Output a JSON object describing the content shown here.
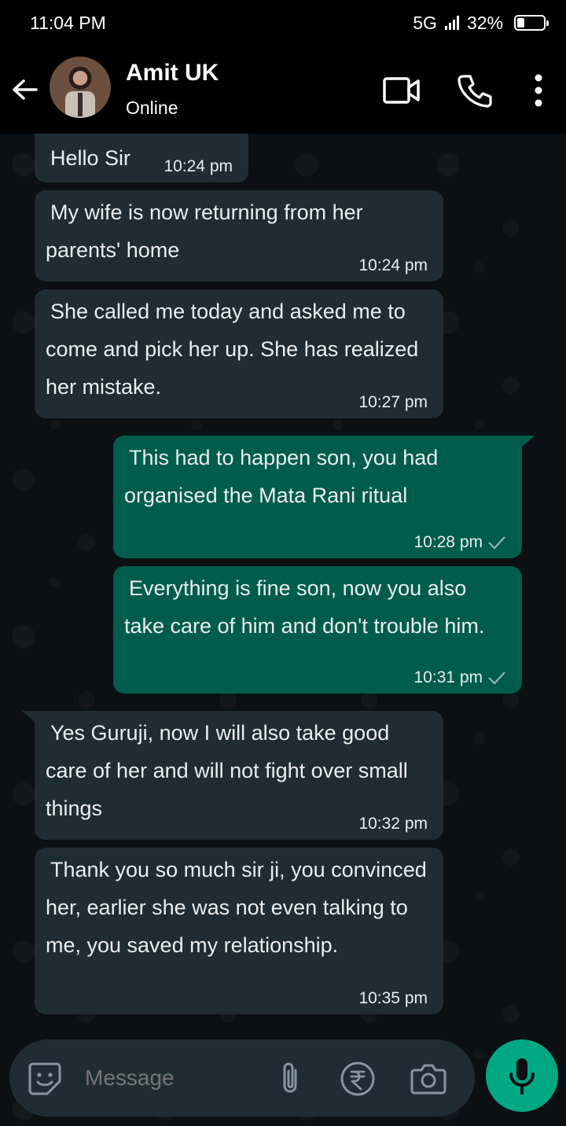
{
  "status_bar": {
    "time": "11:04 PM",
    "network": "5G",
    "battery": "32%"
  },
  "header": {
    "contact_name": "Amit UK",
    "contact_status": "Online",
    "icons": [
      "back-arrow-icon",
      "video-call-icon",
      "voice-call-icon",
      "more-options-icon"
    ]
  },
  "messages": [
    {
      "direction": "in",
      "text": "Hello Sir",
      "time": "10:24 pm"
    },
    {
      "direction": "in",
      "text": "My wife is now returning from her parents' home",
      "time": "10:24 pm"
    },
    {
      "direction": "in",
      "text": "She called me today and asked me to come and pick her up. She has realized her mistake.",
      "time": "10:27 pm"
    },
    {
      "direction": "out",
      "text": "This had to happen son, you had organised the Mata Rani ritual",
      "time": "10:28 pm",
      "status": "sent"
    },
    {
      "direction": "out",
      "text": "Everything is fine son, now you also take care of him and don't trouble him.",
      "time": "10:31 pm",
      "status": "sent"
    },
    {
      "direction": "in",
      "text": "Yes Guruji, now I will also take good care of her and will not fight over small things",
      "time": "10:32 pm"
    },
    {
      "direction": "in",
      "text": "Thank you so much sir ji, you convinced her, earlier she was not even talking to me, you saved my relationship.",
      "time": "10:35 pm"
    }
  ],
  "composer": {
    "placeholder": "Message",
    "icons": [
      "sticker-icon",
      "attach-icon",
      "rupee-payment-icon",
      "camera-icon",
      "mic-icon"
    ]
  },
  "colors": {
    "incoming_bubble": "#1f2c33",
    "outgoing_bubble": "#005c4b",
    "accent": "#00a884",
    "background": "#0b1014"
  }
}
